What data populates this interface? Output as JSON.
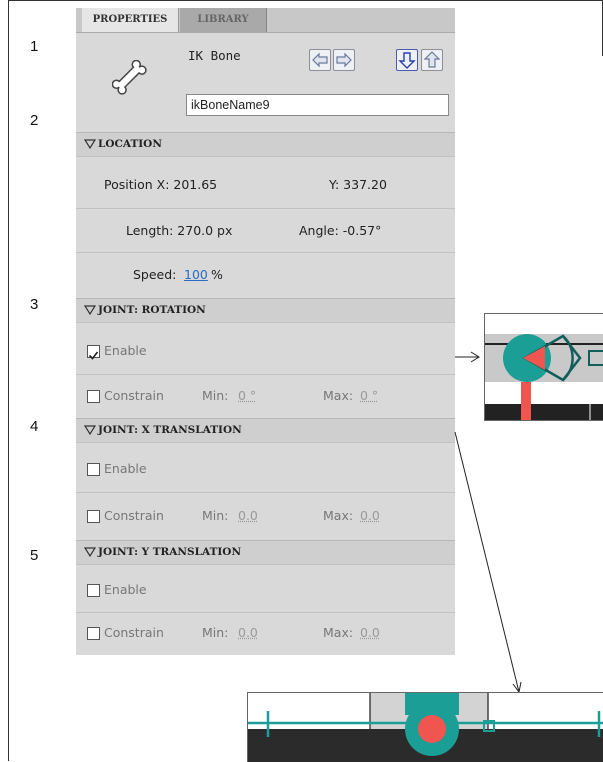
{
  "step_numbers": [
    "1",
    "2",
    "3",
    "4",
    "5"
  ],
  "tabs": {
    "properties": "PROPERTIES",
    "library": "LIBRARY"
  },
  "bone": {
    "type_label": "IK Bone",
    "name_value": "ikBoneName9",
    "icon": "bone-icon"
  },
  "nav_buttons": [
    "arrow-left-icon",
    "arrow-right-icon",
    "arrow-down-icon",
    "arrow-up-icon"
  ],
  "location": {
    "header": "LOCATION",
    "position_x": "Position X: 201.65",
    "y": "Y: 337.20",
    "length": "Length: 270.0 px",
    "angle": "Angle: -0.57°",
    "speed_label": "Speed:",
    "speed_value": "100",
    "speed_unit": "%"
  },
  "joint_rotation": {
    "header": "JOINT: ROTATION",
    "enable": "Enable",
    "enable_checked": true,
    "constrain": "Constrain",
    "min_label": "Min:",
    "min_value": "0 °",
    "max_label": "Max:",
    "max_value": "0 °"
  },
  "joint_x": {
    "header": "JOINT: X TRANSLATION",
    "enable": "Enable",
    "constrain": "Constrain",
    "min_label": "Min:",
    "min_value": "0.0",
    "max_label": "Max:",
    "max_value": "0.0"
  },
  "joint_y": {
    "header": "JOINT: Y TRANSLATION",
    "enable": "Enable",
    "constrain": "Constrain",
    "min_label": "Min:",
    "min_value": "0.0",
    "max_label": "Max:",
    "max_value": "0.0"
  },
  "colors": {
    "teal": "#1a9e96",
    "red": "#f0564f",
    "link": "#2a6bc4",
    "panel": "#d9d9d9"
  }
}
